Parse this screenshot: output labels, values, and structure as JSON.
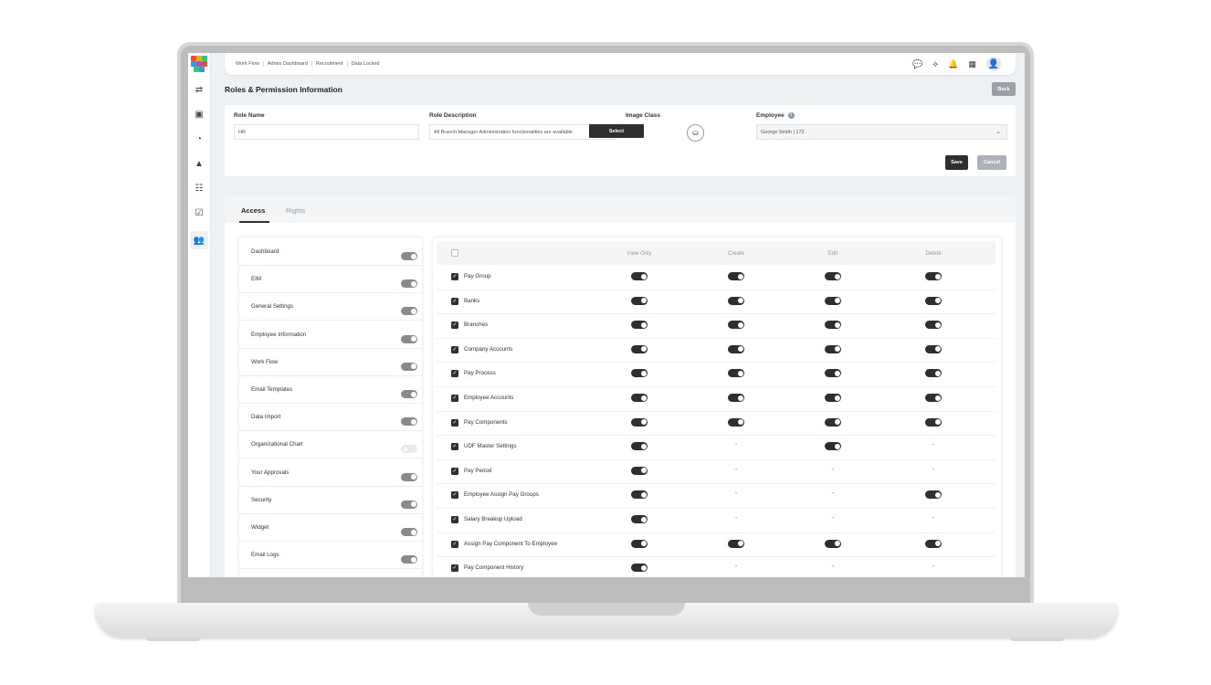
{
  "breadcrumbs": [
    "Work Flow",
    "Admin Dashboard",
    "Recruitment",
    "Data Locked"
  ],
  "page_title": "Roles & Permission Information",
  "back_label": "Back",
  "form": {
    "role_name_label": "Role Name",
    "role_name_value": "HR",
    "role_description_label": "Role Description",
    "role_description_value": "All Branch Manager Administration functionalities are available",
    "image_class_label": "Image Class",
    "select_label": "Select",
    "employee_label": "Employee",
    "employee_value": "George Smith | 172",
    "save_label": "Save",
    "cancel_label": "Cancel"
  },
  "tabs": [
    {
      "label": "Access",
      "active": true
    },
    {
      "label": "Rights",
      "active": false
    }
  ],
  "access_items": [
    {
      "label": "Dashboard",
      "enabled": true
    },
    {
      "label": "EIM",
      "enabled": true
    },
    {
      "label": "General Settings",
      "enabled": true
    },
    {
      "label": "Employee Information",
      "enabled": true
    },
    {
      "label": "Work Flow",
      "enabled": true
    },
    {
      "label": "Email Templates",
      "enabled": true
    },
    {
      "label": "Data Import",
      "enabled": true
    },
    {
      "label": "Organizational Chart",
      "enabled": false
    },
    {
      "label": "Your Approvals",
      "enabled": true
    },
    {
      "label": "Security",
      "enabled": true
    },
    {
      "label": "Widget",
      "enabled": true
    },
    {
      "label": "Email Logs",
      "enabled": true
    }
  ],
  "table": {
    "columns": [
      "View Only",
      "Create",
      "Edit",
      "Delete"
    ],
    "rows": [
      {
        "label": "Pay Group",
        "checked": true,
        "view": "on",
        "create": "on",
        "edit": "on",
        "delete": "on"
      },
      {
        "label": "Banks",
        "checked": true,
        "view": "on",
        "create": "on",
        "edit": "on",
        "delete": "on"
      },
      {
        "label": "Branches",
        "checked": true,
        "view": "on",
        "create": "on",
        "edit": "on",
        "delete": "on"
      },
      {
        "label": "Company Accounts",
        "checked": true,
        "view": "on",
        "create": "on",
        "edit": "on",
        "delete": "on"
      },
      {
        "label": "Pay Process",
        "checked": true,
        "view": "on",
        "create": "on",
        "edit": "on",
        "delete": "on"
      },
      {
        "label": "Employee Accounts",
        "checked": true,
        "view": "on",
        "create": "on",
        "edit": "on",
        "delete": "on"
      },
      {
        "label": "Pay Components",
        "checked": true,
        "view": "on",
        "create": "on",
        "edit": "on",
        "delete": "on"
      },
      {
        "label": "UDF Master Settings",
        "checked": true,
        "view": "on",
        "create": "-",
        "edit": "on",
        "delete": "-"
      },
      {
        "label": "Pay Period",
        "checked": true,
        "view": "on",
        "create": "-",
        "edit": "-",
        "delete": "-"
      },
      {
        "label": "Employee Assign Pay Groups",
        "checked": true,
        "view": "on",
        "create": "-",
        "edit": "-",
        "delete": "on"
      },
      {
        "label": "Salary Breakup Upload",
        "checked": true,
        "view": "on",
        "create": "-",
        "edit": "-",
        "delete": "-"
      },
      {
        "label": "Assign Pay Component To Employee",
        "checked": true,
        "view": "on",
        "create": "on",
        "edit": "on",
        "delete": "on"
      },
      {
        "label": "Pay Component History",
        "checked": true,
        "view": "on",
        "create": "-",
        "edit": "-",
        "delete": "-"
      }
    ]
  },
  "icons": {
    "sidebar": [
      "workflow-icon",
      "id-card-icon",
      "dashboard-gauge-icon",
      "recruitment-icon",
      "org-chart-icon",
      "approvals-icon",
      "users-icon"
    ],
    "topbar": [
      "chat-icon",
      "network-icon",
      "bell-icon",
      "apps-icon",
      "user-avatar-icon"
    ]
  },
  "colors": {
    "accent_dark": "#2f2f2f",
    "back_button": "#9aa0a8",
    "cancel_button": "#aeb3b9"
  }
}
